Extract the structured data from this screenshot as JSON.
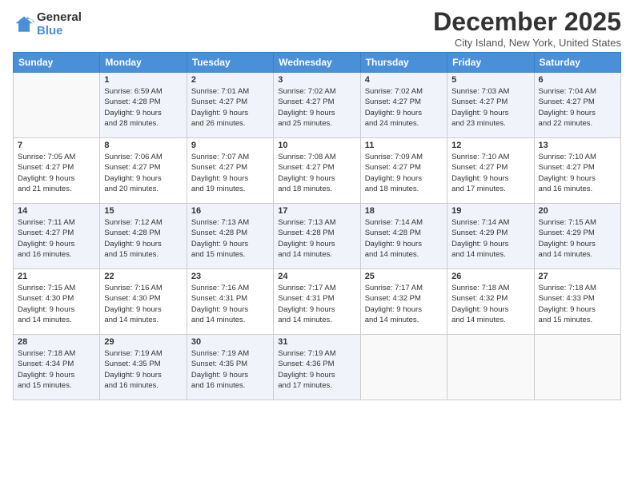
{
  "header": {
    "logo_general": "General",
    "logo_blue": "Blue",
    "title": "December 2025",
    "location": "City Island, New York, United States"
  },
  "days_of_week": [
    "Sunday",
    "Monday",
    "Tuesday",
    "Wednesday",
    "Thursday",
    "Friday",
    "Saturday"
  ],
  "weeks": [
    [
      {
        "day": "",
        "info": ""
      },
      {
        "day": "1",
        "info": "Sunrise: 6:59 AM\nSunset: 4:28 PM\nDaylight: 9 hours\nand 28 minutes."
      },
      {
        "day": "2",
        "info": "Sunrise: 7:01 AM\nSunset: 4:27 PM\nDaylight: 9 hours\nand 26 minutes."
      },
      {
        "day": "3",
        "info": "Sunrise: 7:02 AM\nSunset: 4:27 PM\nDaylight: 9 hours\nand 25 minutes."
      },
      {
        "day": "4",
        "info": "Sunrise: 7:02 AM\nSunset: 4:27 PM\nDaylight: 9 hours\nand 24 minutes."
      },
      {
        "day": "5",
        "info": "Sunrise: 7:03 AM\nSunset: 4:27 PM\nDaylight: 9 hours\nand 23 minutes."
      },
      {
        "day": "6",
        "info": "Sunrise: 7:04 AM\nSunset: 4:27 PM\nDaylight: 9 hours\nand 22 minutes."
      }
    ],
    [
      {
        "day": "7",
        "info": "Sunrise: 7:05 AM\nSunset: 4:27 PM\nDaylight: 9 hours\nand 21 minutes."
      },
      {
        "day": "8",
        "info": "Sunrise: 7:06 AM\nSunset: 4:27 PM\nDaylight: 9 hours\nand 20 minutes."
      },
      {
        "day": "9",
        "info": "Sunrise: 7:07 AM\nSunset: 4:27 PM\nDaylight: 9 hours\nand 19 minutes."
      },
      {
        "day": "10",
        "info": "Sunrise: 7:08 AM\nSunset: 4:27 PM\nDaylight: 9 hours\nand 18 minutes."
      },
      {
        "day": "11",
        "info": "Sunrise: 7:09 AM\nSunset: 4:27 PM\nDaylight: 9 hours\nand 18 minutes."
      },
      {
        "day": "12",
        "info": "Sunrise: 7:10 AM\nSunset: 4:27 PM\nDaylight: 9 hours\nand 17 minutes."
      },
      {
        "day": "13",
        "info": "Sunrise: 7:10 AM\nSunset: 4:27 PM\nDaylight: 9 hours\nand 16 minutes."
      }
    ],
    [
      {
        "day": "14",
        "info": "Sunrise: 7:11 AM\nSunset: 4:27 PM\nDaylight: 9 hours\nand 16 minutes."
      },
      {
        "day": "15",
        "info": "Sunrise: 7:12 AM\nSunset: 4:28 PM\nDaylight: 9 hours\nand 15 minutes."
      },
      {
        "day": "16",
        "info": "Sunrise: 7:13 AM\nSunset: 4:28 PM\nDaylight: 9 hours\nand 15 minutes."
      },
      {
        "day": "17",
        "info": "Sunrise: 7:13 AM\nSunset: 4:28 PM\nDaylight: 9 hours\nand 14 minutes."
      },
      {
        "day": "18",
        "info": "Sunrise: 7:14 AM\nSunset: 4:28 PM\nDaylight: 9 hours\nand 14 minutes."
      },
      {
        "day": "19",
        "info": "Sunrise: 7:14 AM\nSunset: 4:29 PM\nDaylight: 9 hours\nand 14 minutes."
      },
      {
        "day": "20",
        "info": "Sunrise: 7:15 AM\nSunset: 4:29 PM\nDaylight: 9 hours\nand 14 minutes."
      }
    ],
    [
      {
        "day": "21",
        "info": "Sunrise: 7:15 AM\nSunset: 4:30 PM\nDaylight: 9 hours\nand 14 minutes."
      },
      {
        "day": "22",
        "info": "Sunrise: 7:16 AM\nSunset: 4:30 PM\nDaylight: 9 hours\nand 14 minutes."
      },
      {
        "day": "23",
        "info": "Sunrise: 7:16 AM\nSunset: 4:31 PM\nDaylight: 9 hours\nand 14 minutes."
      },
      {
        "day": "24",
        "info": "Sunrise: 7:17 AM\nSunset: 4:31 PM\nDaylight: 9 hours\nand 14 minutes."
      },
      {
        "day": "25",
        "info": "Sunrise: 7:17 AM\nSunset: 4:32 PM\nDaylight: 9 hours\nand 14 minutes."
      },
      {
        "day": "26",
        "info": "Sunrise: 7:18 AM\nSunset: 4:32 PM\nDaylight: 9 hours\nand 14 minutes."
      },
      {
        "day": "27",
        "info": "Sunrise: 7:18 AM\nSunset: 4:33 PM\nDaylight: 9 hours\nand 15 minutes."
      }
    ],
    [
      {
        "day": "28",
        "info": "Sunrise: 7:18 AM\nSunset: 4:34 PM\nDaylight: 9 hours\nand 15 minutes."
      },
      {
        "day": "29",
        "info": "Sunrise: 7:19 AM\nSunset: 4:35 PM\nDaylight: 9 hours\nand 16 minutes."
      },
      {
        "day": "30",
        "info": "Sunrise: 7:19 AM\nSunset: 4:35 PM\nDaylight: 9 hours\nand 16 minutes."
      },
      {
        "day": "31",
        "info": "Sunrise: 7:19 AM\nSunset: 4:36 PM\nDaylight: 9 hours\nand 17 minutes."
      },
      {
        "day": "",
        "info": ""
      },
      {
        "day": "",
        "info": ""
      },
      {
        "day": "",
        "info": ""
      }
    ]
  ]
}
